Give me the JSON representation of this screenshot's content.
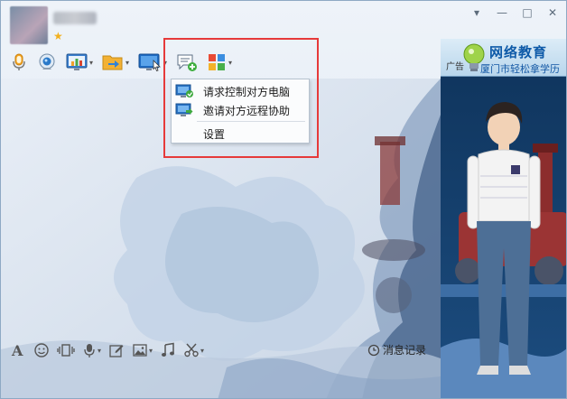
{
  "window": {
    "controls": {
      "dropdown": "▾",
      "minimize": "—",
      "maximize": "□",
      "close": "✕"
    }
  },
  "profile": {
    "star": "★"
  },
  "toolbar": {
    "items": [
      {
        "name": "voice-call-button",
        "icon": "microphone-icon"
      },
      {
        "name": "video-call-button",
        "icon": "webcam-icon"
      },
      {
        "name": "screen-share-button",
        "icon": "monitor-chart-icon",
        "has_arrow": true
      },
      {
        "name": "file-transfer-button",
        "icon": "folder-arrow-icon",
        "has_arrow": true
      },
      {
        "name": "remote-assist-button",
        "icon": "remote-desktop-icon",
        "has_arrow": true
      },
      {
        "name": "chat-add-button",
        "icon": "chat-plus-icon"
      },
      {
        "name": "apps-button",
        "icon": "apps-grid-icon",
        "has_arrow": true
      }
    ],
    "arrow": "▾"
  },
  "menu": {
    "items": [
      {
        "label": "请求控制对方电脑",
        "icon": "request-control-icon"
      },
      {
        "label": "邀请对方远程协助",
        "icon": "invite-assist-icon"
      },
      {
        "label": "设置",
        "icon": ""
      }
    ]
  },
  "ad": {
    "tag": "广告",
    "title": "网络教育",
    "subtitle": "厦门市轻松拿学历"
  },
  "bottom_toolbar": {
    "arrow": "▾",
    "history_label": "消息记录"
  },
  "colors": {
    "highlight": "#e63a3a",
    "accent_blue": "#1a6fc7",
    "window_bg": "#e7eef6"
  }
}
